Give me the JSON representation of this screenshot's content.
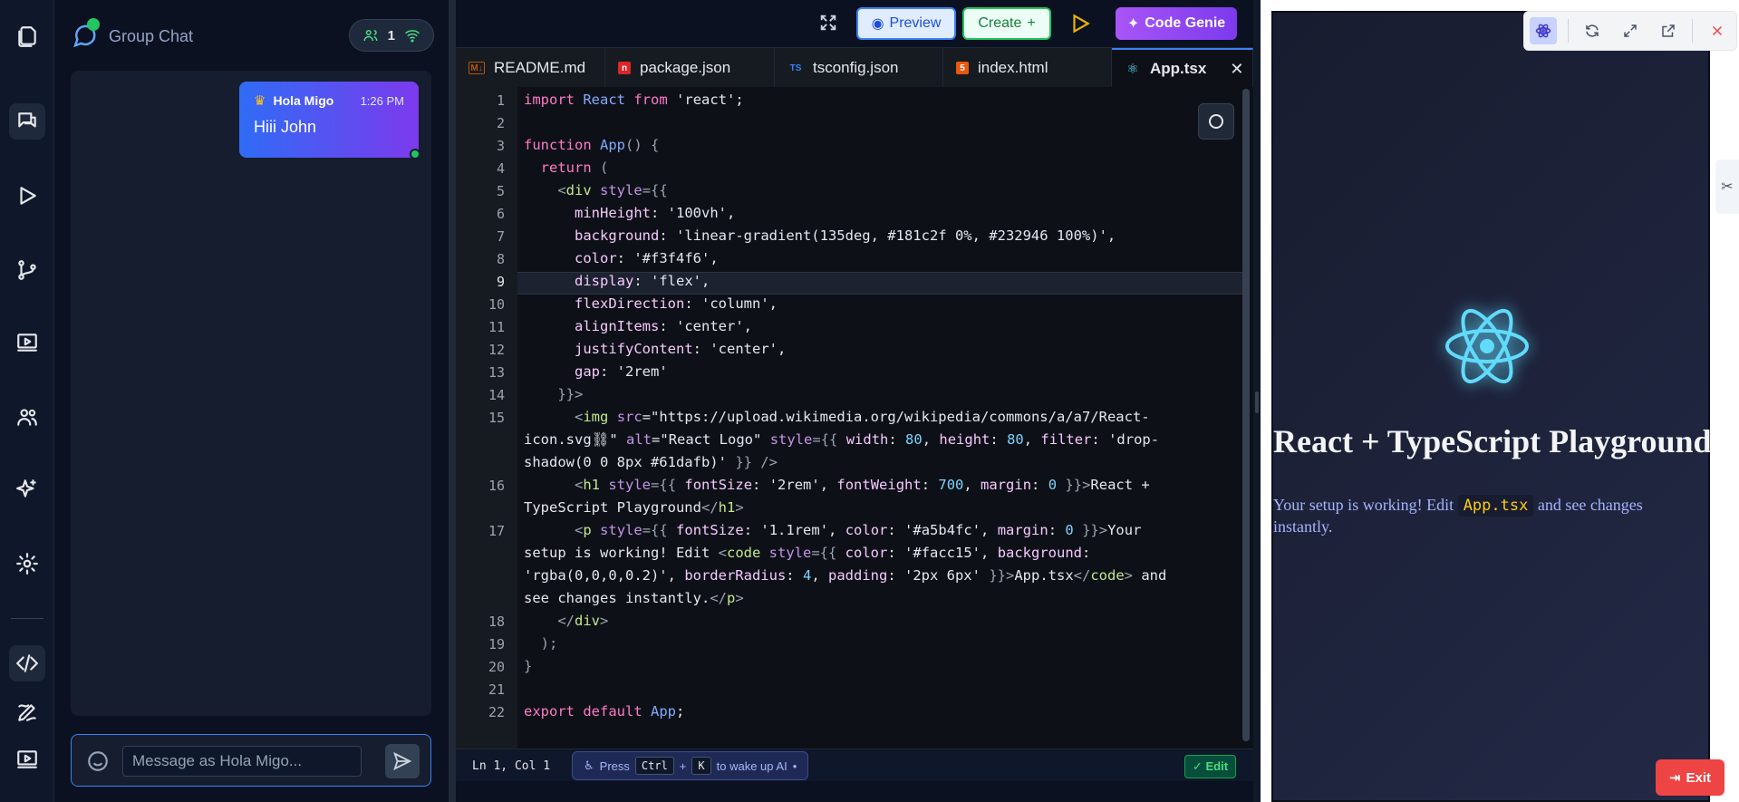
{
  "chat": {
    "title": "Group Chat",
    "online_count": "1",
    "message": {
      "sender": "Hola Migo",
      "time": "1:26 PM",
      "text": "Hiii John"
    },
    "input_placeholder": "Message as Hola Migo..."
  },
  "toolbar": {
    "preview_label": "Preview",
    "create_label": "Create",
    "create_icon": "+",
    "genie_label": "Code Genie"
  },
  "tabs": [
    {
      "label": "README.md",
      "icon_text": "M↓",
      "icon_color": "#b45309"
    },
    {
      "label": "package.json",
      "icon_text": "n",
      "icon_color": "#dc2626"
    },
    {
      "label": "tsconfig.json",
      "icon_text": "TS",
      "icon_color": "#3b82f6"
    },
    {
      "label": "index.html",
      "icon_text": "5",
      "icon_color": "#ea580c"
    },
    {
      "label": "App.tsx",
      "icon_text": "⚛",
      "icon_color": "#61dafb"
    }
  ],
  "code": {
    "line_numbers": [
      "1",
      "2",
      "3",
      "4",
      "5",
      "6",
      "7",
      "8",
      "9",
      "10",
      "11",
      "12",
      "13",
      "14",
      "15",
      "16",
      "17",
      "18",
      "19",
      "20",
      "21",
      "22"
    ],
    "current_line": "9"
  },
  "status": {
    "position": "Ln 1, Col 1",
    "hint_press": "Press",
    "hint_key1": "Ctrl",
    "hint_plus": "+",
    "hint_key2": "K",
    "hint_tail": "to wake up AI",
    "edit_label": "✓ Edit"
  },
  "preview": {
    "heading": "React + TypeScript Playground",
    "para_before": "Your setup is working! Edit",
    "para_code": "App.tsx",
    "para_after": "and see changes instantly.",
    "exit_label": "Exit"
  },
  "colors": {
    "accent": "#3b82f6",
    "genie": "#7c3aed",
    "success": "#22c55e",
    "danger": "#ef4444",
    "react": "#61dafb"
  }
}
